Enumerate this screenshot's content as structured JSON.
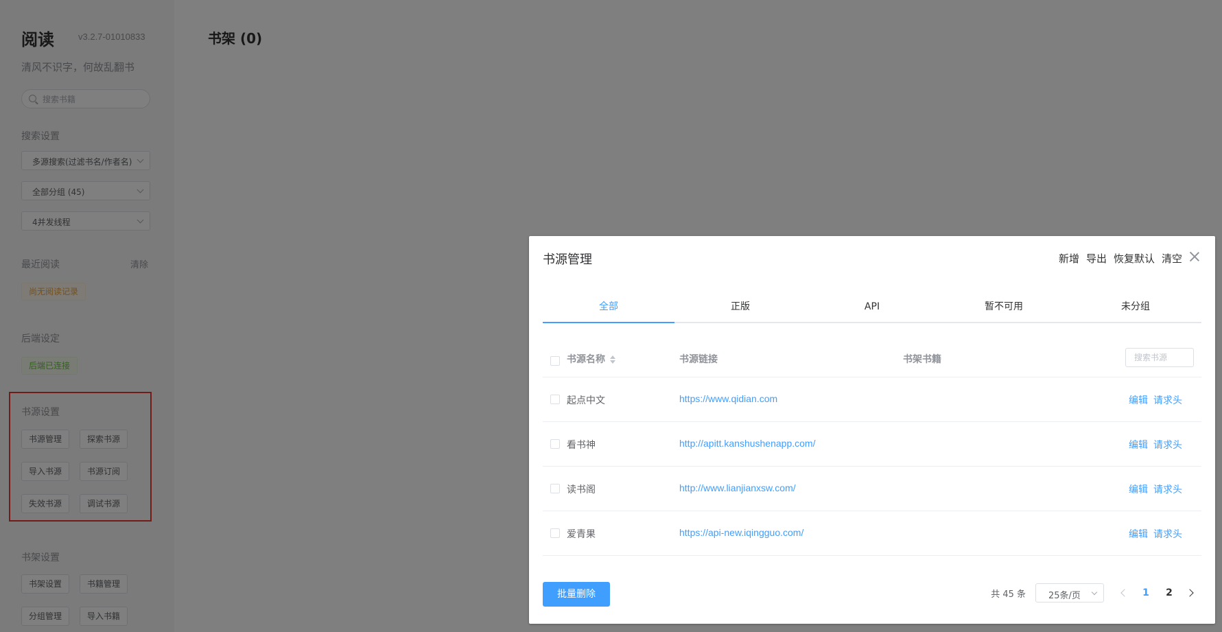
{
  "sidebar": {
    "title": "阅读",
    "version": "v3.2.7-01010833",
    "subtitle": "清风不识字，何故乱翻书",
    "search_placeholder": "搜索书籍",
    "search_settings_label": "搜索设置",
    "search_mode": "多源搜索(过滤书名/作者名)",
    "group_select": "全部分组 (45)",
    "threads_select": "4并发线程",
    "recent_label": "最近阅读",
    "recent_clear": "清除",
    "recent_empty": "尚无阅读记录",
    "backend_label": "后端设定",
    "backend_status": "后端已连接",
    "source_settings_label": "书源设置",
    "source_buttons": [
      "书源管理",
      "探索书源",
      "导入书源",
      "书源订阅",
      "失效书源",
      "调试书源"
    ],
    "shelf_settings_label": "书架设置",
    "shelf_buttons": [
      "书架设置",
      "书籍管理",
      "分组管理",
      "导入书籍"
    ]
  },
  "main": {
    "title": "书架 (0)"
  },
  "dialog": {
    "title": "书源管理",
    "actions": [
      "新增",
      "导出",
      "恢复默认",
      "清空"
    ],
    "tabs": [
      "全部",
      "正版",
      "API",
      "暂不可用",
      "未分组"
    ],
    "active_tab": "全部",
    "columns": {
      "name": "书源名称",
      "url": "书源链接",
      "shelf": "书架书籍"
    },
    "search_placeholder": "搜索书源",
    "rows": [
      {
        "name": "起点中文",
        "url": "https://www.qidian.com",
        "edit": "编辑",
        "headers": "请求头"
      },
      {
        "name": "看书神",
        "url": "http://apitt.kanshushenapp.com/",
        "edit": "编辑",
        "headers": "请求头"
      },
      {
        "name": "读书阁",
        "url": "http://www.lianjianxsw.com/",
        "edit": "编辑",
        "headers": "请求头"
      },
      {
        "name": "爱青果",
        "url": "https://api-new.iqingguo.com/",
        "edit": "编辑",
        "headers": "请求头"
      }
    ],
    "batch_delete": "批量删除",
    "pagination": {
      "total": "共 45 条",
      "page_size": "25条/页",
      "pages": [
        "1",
        "2"
      ],
      "current_page": "1"
    }
  },
  "colors": {
    "accent": "#409eff",
    "highlight_box": "#e53935",
    "warning": "#e6a23c",
    "success": "#67c23a"
  }
}
